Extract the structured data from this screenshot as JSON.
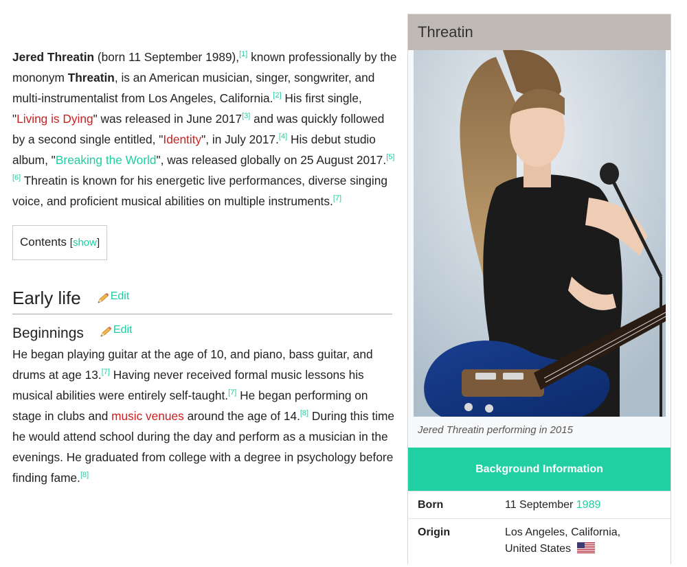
{
  "article": {
    "intro": {
      "name_bold": "Jered Threatin",
      "t1": " (born 11 September 1989),",
      "c1": "[1]",
      "t2": " known professionally by the mononym ",
      "mononym": "Threatin",
      "t3": ", is an American musician, singer, songwriter, and multi-instrumentalist from Los Angeles, California.",
      "c2": "[2]",
      "t4": " His first single, \"",
      "link_single1": "Living is Dying",
      "t5": "\" was released in June 2017",
      "c3": "[3]",
      "t6": " and was quickly followed by a second single entitled, \"",
      "link_single2": "Identity",
      "t7": "\", in July 2017.",
      "c4": "[4]",
      "t8": " His debut studio album, \"",
      "link_album": "Breaking the World",
      "t9": "\", was released globally on 25 August 2017.",
      "c5": "[5]",
      "c6": "[6]",
      "t10": " Threatin is known for his energetic live performances, diverse singing voice, and proficient musical abilities on multiple instruments.",
      "c7": "[7]"
    },
    "toc": {
      "label": "Contents",
      "open_bracket": "[",
      "toggle": "show",
      "close_bracket": "]"
    },
    "section_early_life": {
      "title": "Early life",
      "edit": "Edit"
    },
    "subsection_beginnings": {
      "title": "Beginnings",
      "edit": "Edit"
    },
    "beginnings": {
      "t1": "He began playing guitar at the age of 10, and piano, bass guitar, and drums at age 13.",
      "c1": "[7]",
      "t2": " Having never received formal music lessons his musical abilities were entirely self-taught.",
      "c2": "[7]",
      "t3": " He began performing on stage in clubs and ",
      "link_venues": "music venues",
      "t4": " around the age of 14.",
      "c3": "[8]",
      "t5": " During this time he would attend school during the day and perform as a musician in the evenings. He graduated from college with a degree in psychology before finding fame.",
      "c4": "[8]"
    }
  },
  "infobox": {
    "title": "Threatin",
    "caption": "Jered Threatin performing in 2015",
    "section_header": "Background Information",
    "born": {
      "label": "Born",
      "value": "11 September ",
      "year_link": "1989"
    },
    "origin": {
      "label": "Origin",
      "line1": "Los Angeles, California,",
      "line2": "United States"
    }
  },
  "colors": {
    "link_blue_green": "#1ccfa0",
    "red_link": "#cc1f1f",
    "infobox_header": "#bfb9b5",
    "section_header": "#21d0a2"
  },
  "icons": {
    "edit": "pencil-icon",
    "flag": "us-flag-icon"
  }
}
